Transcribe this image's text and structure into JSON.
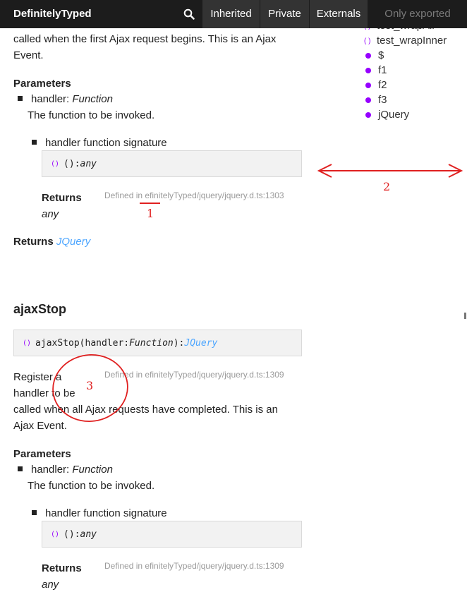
{
  "toolbar": {
    "brand": "DefinitelyTyped",
    "search_icon": "search-icon",
    "tabs": [
      {
        "label": "Inherited"
      },
      {
        "label": "Private"
      },
      {
        "label": "Externals"
      },
      {
        "label": "Only exported"
      }
    ]
  },
  "sidebar": {
    "items": [
      {
        "label": "test_wrapAll",
        "icon": "parens-icon"
      },
      {
        "label": "test_wrapInner",
        "icon": "parens-icon"
      },
      {
        "label": "$",
        "icon": "dot-icon"
      },
      {
        "label": "f1",
        "icon": "dot-icon"
      },
      {
        "label": "f2",
        "icon": "dot-icon"
      },
      {
        "label": "f3",
        "icon": "dot-icon"
      },
      {
        "label": "jQuery",
        "icon": "dot-icon"
      }
    ]
  },
  "ajax_start": {
    "desc_line1": "called when the first Ajax request begins. This is an Ajax",
    "desc_line2": "Event.",
    "params_heading": "Parameters",
    "param_name": "handler: ",
    "param_type": "Function",
    "param_desc": "The function to be invoked.",
    "sig_label": "handler function signature",
    "sig_paren": "()",
    "sig_code": "(): ",
    "sig_type": "any",
    "returns_label": "Returns",
    "returns_value": "any",
    "defined": "Defined in efinitelyTyped/jquery/jquery.d.ts:1303",
    "outer_returns_label": "Returns ",
    "outer_returns_type": "JQuery"
  },
  "ajax_stop": {
    "title": "ajaxStop",
    "sig_paren": "()",
    "sig_name": "ajaxStop(handler: ",
    "sig_param_type": "Function",
    "sig_close": "): ",
    "sig_return": "JQuery",
    "defined": "Defined in efinitelyTyped/jquery/jquery.d.ts:1309",
    "desc_line1": "Register a",
    "desc_line2": "handler to be",
    "desc_line3": "called when all Ajax requests have completed. This is an",
    "desc_line4": "Ajax Event.",
    "params_heading": "Parameters",
    "param_name": "handler: ",
    "param_type": "Function",
    "param_desc": "The function to be invoked.",
    "sig_label": "handler function signature",
    "sub_paren": "()",
    "sub_code": "(): ",
    "sub_type": "any",
    "returns_label": "Returns",
    "returns_value": "any",
    "defined2": "Defined in efinitelyTyped/jquery/jquery.d.ts:1309"
  },
  "annotations": {
    "n1": "1",
    "n2": "2",
    "n3": "3",
    "color": "#e02020"
  },
  "colors": {
    "toolbar_bg": "#1c1c1c",
    "tab_bg": "#333333",
    "accent_purple": "#9600ff",
    "link_blue": "#4da6ff"
  }
}
